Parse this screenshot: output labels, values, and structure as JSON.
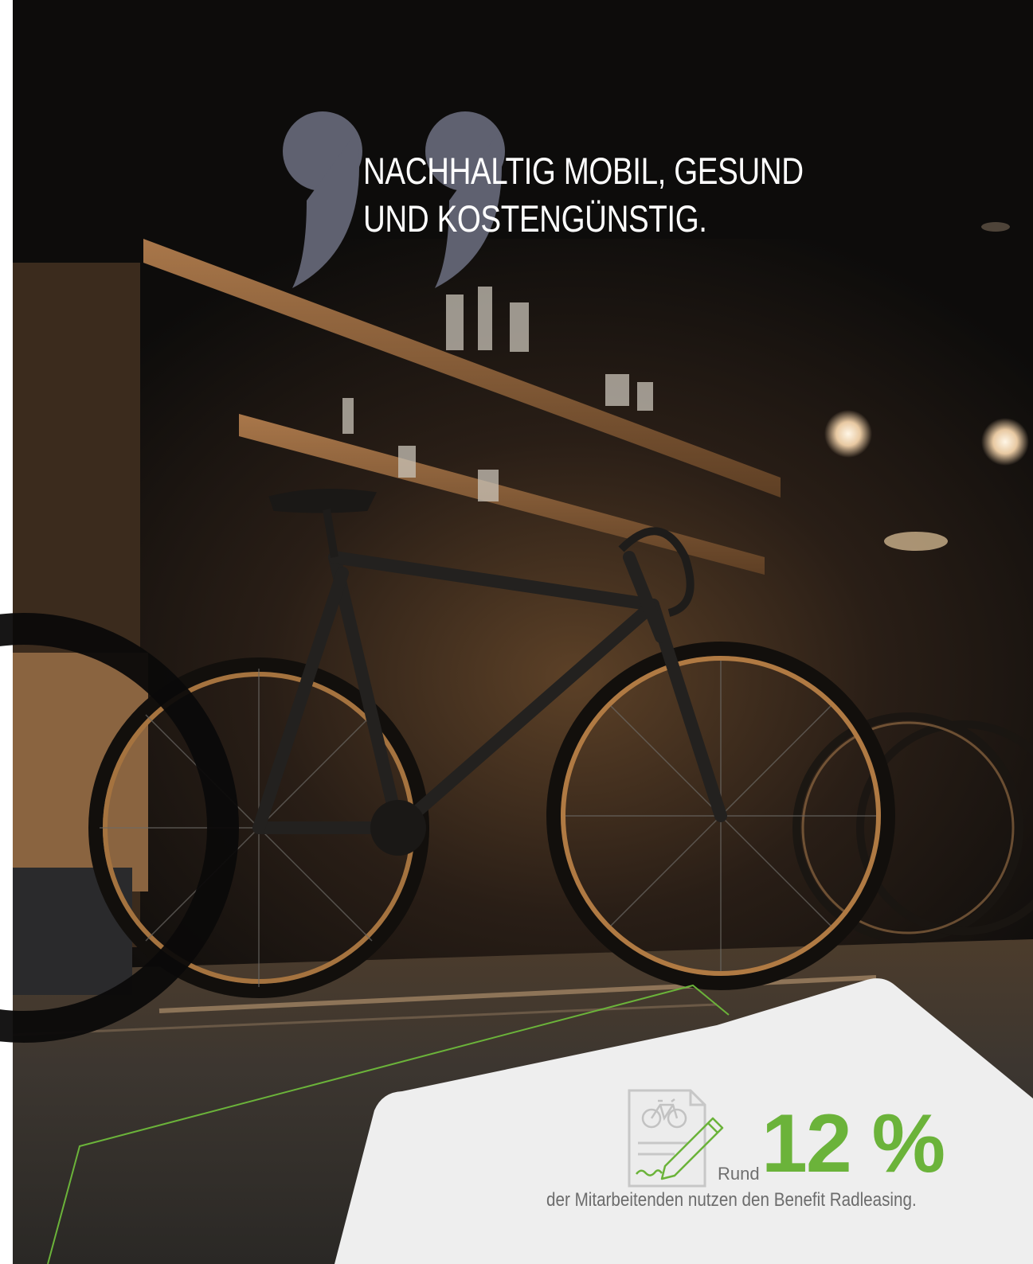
{
  "quote": {
    "headline_line1": "NACHHALTIG MOBIL, GESUND",
    "headline_line2": "UND KOSTENGÜNSTIG."
  },
  "stat": {
    "prefix": "Rund",
    "value": "12 %",
    "caption": "der Mitarbeitenden nutzen den Benefit Radleasing.",
    "icon": "bike-leasing-contract-icon"
  },
  "colors": {
    "accent_green": "#6bb33a",
    "panel_gray": "#eeeeee",
    "quote_mark_gray": "#5f6170",
    "headline_text": "#ffffff",
    "caption_text": "#6c6c6c"
  }
}
